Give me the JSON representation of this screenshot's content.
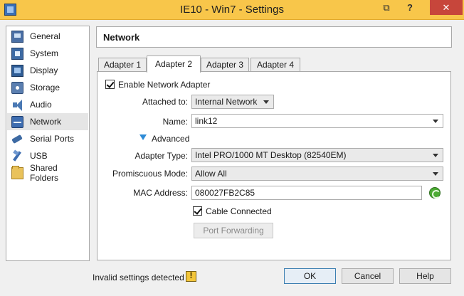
{
  "window": {
    "title": "IE10 - Win7 - Settings",
    "help_glyph": "?",
    "close_glyph": "✕",
    "restore_glyph": "⧉"
  },
  "sidebar": {
    "items": [
      {
        "label": "General",
        "icon": "general-icon"
      },
      {
        "label": "System",
        "icon": "system-icon"
      },
      {
        "label": "Display",
        "icon": "display-icon"
      },
      {
        "label": "Storage",
        "icon": "storage-icon"
      },
      {
        "label": "Audio",
        "icon": "audio-icon"
      },
      {
        "label": "Network",
        "icon": "network-icon",
        "selected": true
      },
      {
        "label": "Serial Ports",
        "icon": "serial-port-icon"
      },
      {
        "label": "USB",
        "icon": "usb-icon"
      },
      {
        "label": "Shared Folders",
        "icon": "shared-folder-icon"
      }
    ]
  },
  "page": {
    "title": "Network"
  },
  "tabs": [
    {
      "label": "Adapter 1"
    },
    {
      "label": "Adapter 2",
      "active": true
    },
    {
      "label": "Adapter 3"
    },
    {
      "label": "Adapter 4"
    }
  ],
  "adapter": {
    "enable_label": "Enable Network Adapter",
    "enable_checked": true,
    "attached_label": "Attached to:",
    "attached_value": "Internal Network",
    "name_label": "Name:",
    "name_value": "link12",
    "advanced_label": "Advanced",
    "adapter_type_label": "Adapter Type:",
    "adapter_type_value": "Intel PRO/1000 MT Desktop (82540EM)",
    "promiscuous_label": "Promiscuous Mode:",
    "promiscuous_value": "Allow All",
    "mac_label": "MAC Address:",
    "mac_value": "080027FB2C85",
    "cable_label": "Cable Connected",
    "cable_checked": true,
    "port_forwarding_label": "Port Forwarding"
  },
  "footer": {
    "status": "Invalid settings detected",
    "ok_label": "OK",
    "cancel_label": "Cancel",
    "help_label": "Help"
  },
  "colors": {
    "titlebar": "#f8c64a",
    "close_button": "#c7463b",
    "advanced_arrow": "#2e8bd6",
    "refresh": "#4cab33"
  }
}
